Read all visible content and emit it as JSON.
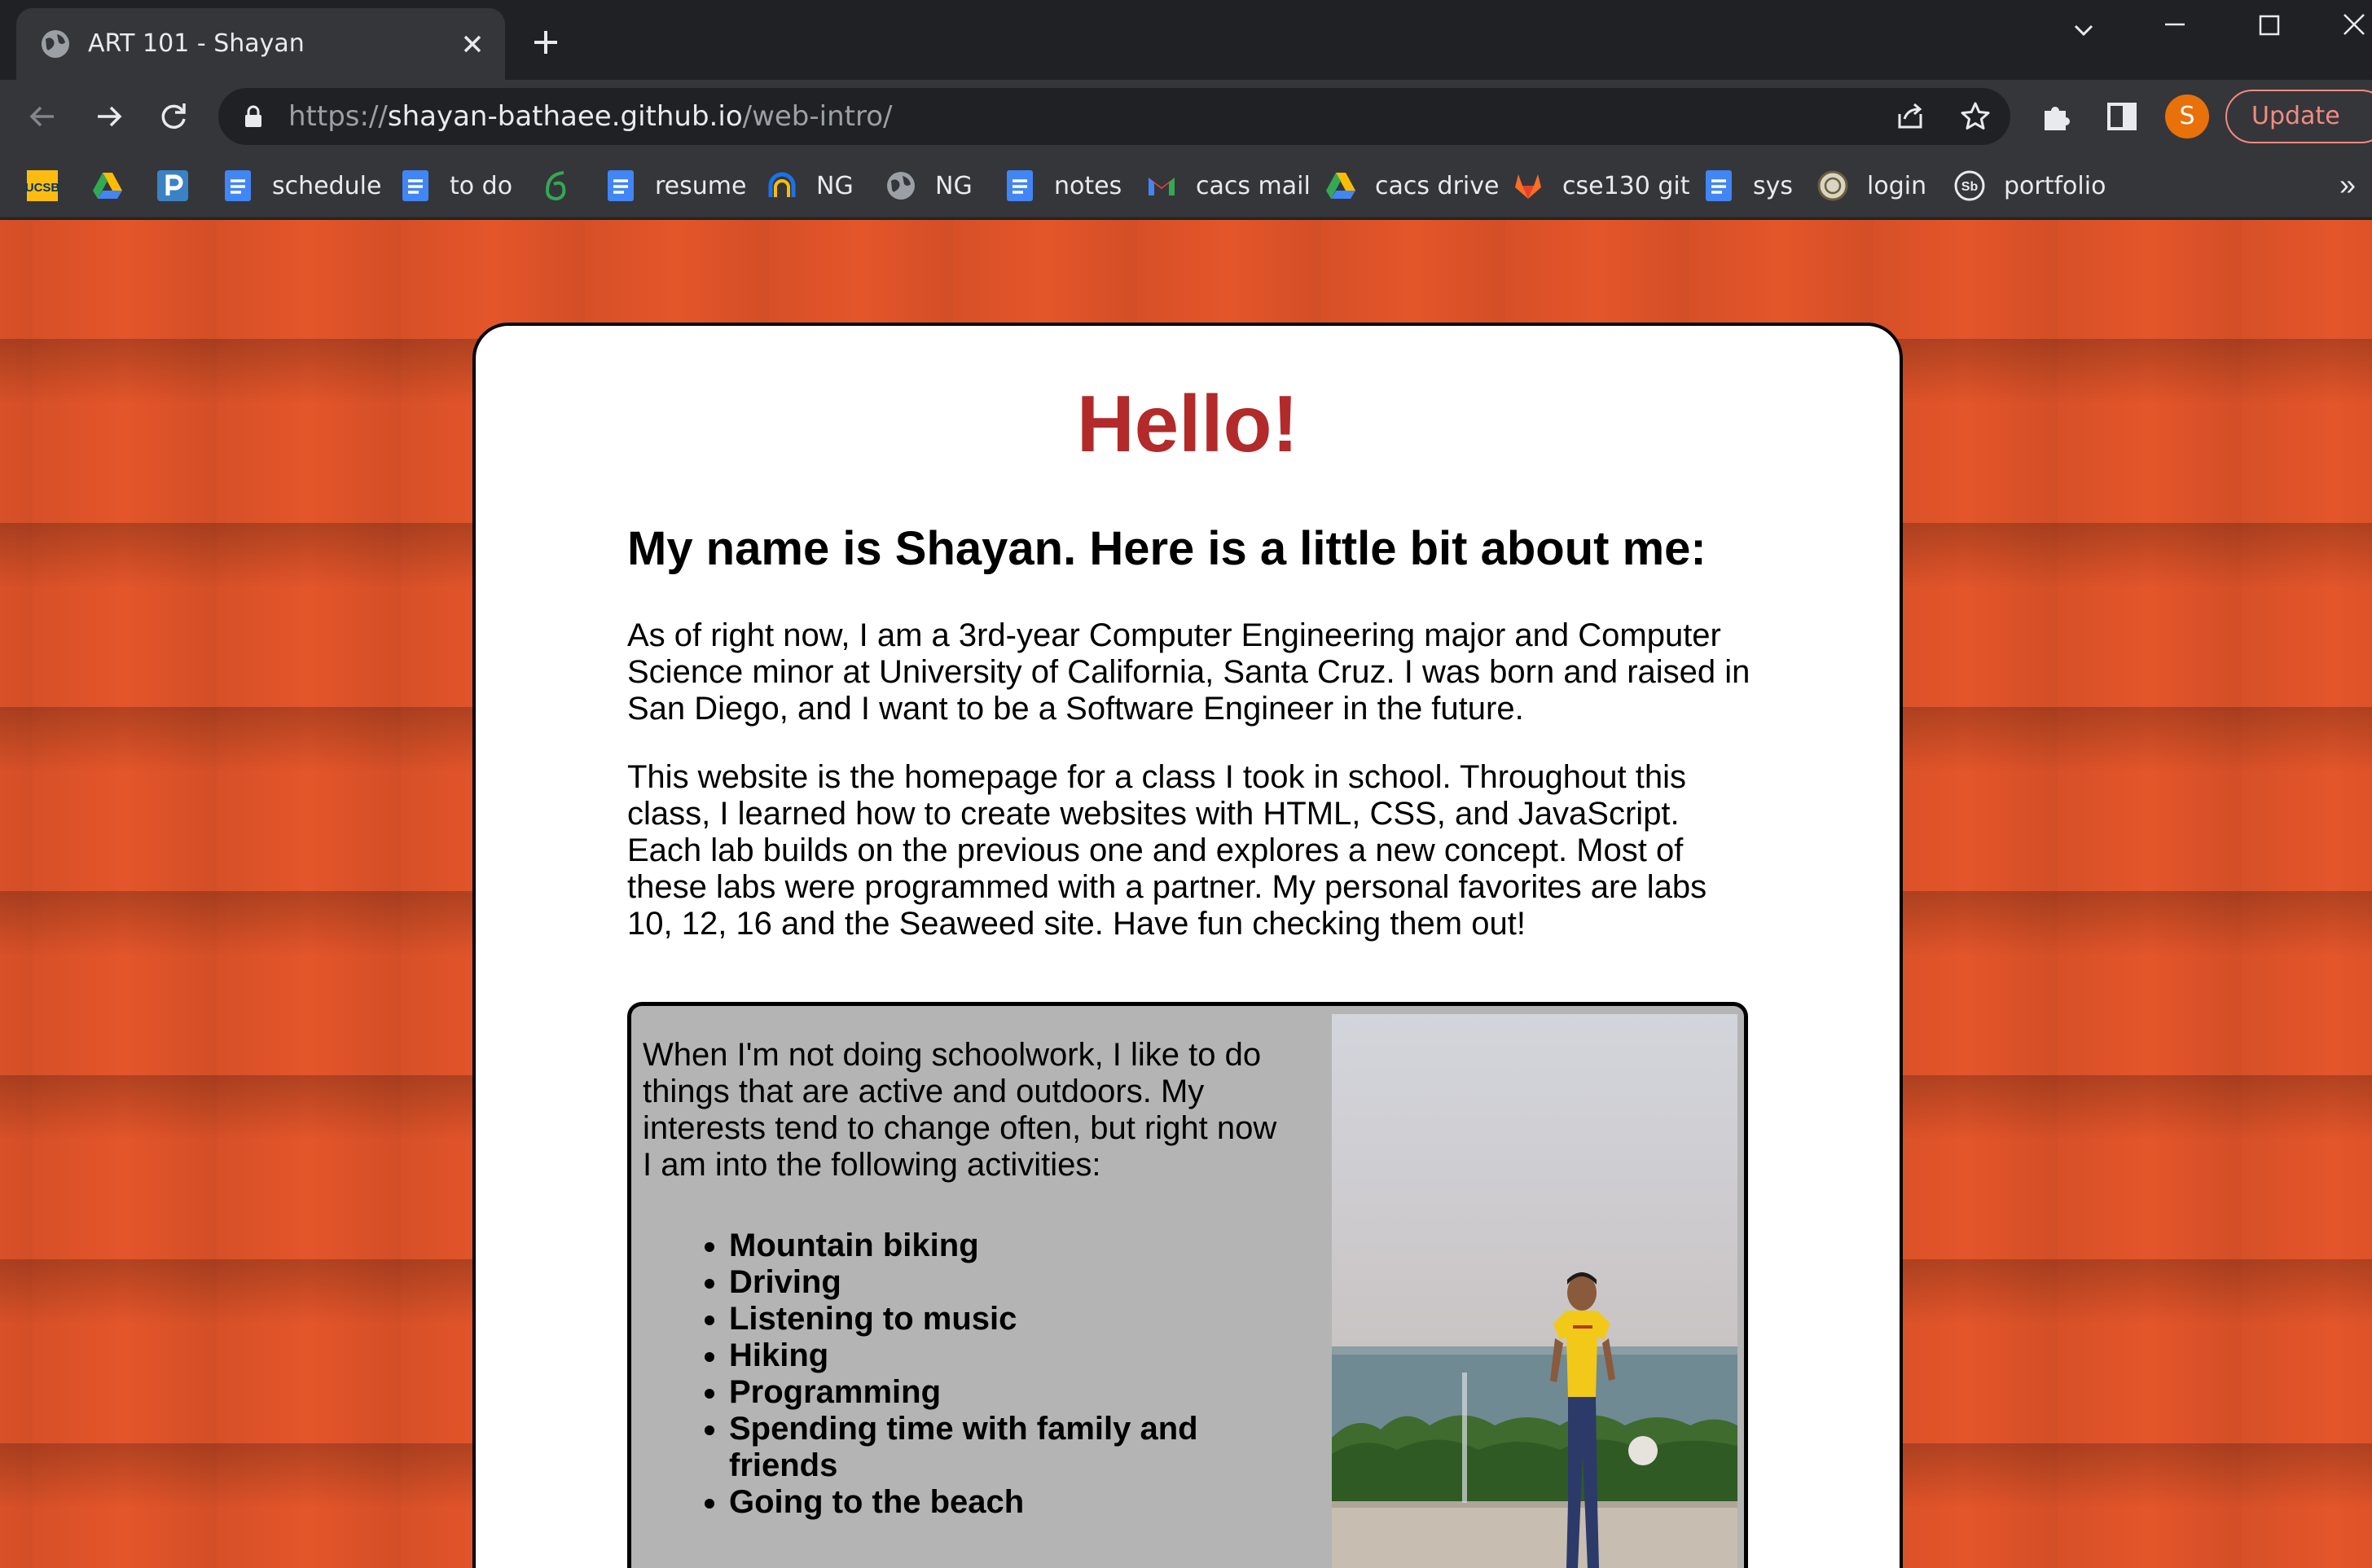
{
  "tab": {
    "title": "ART 101 - Shayan"
  },
  "address_bar": {
    "scheme": "https://",
    "host": "shayan-bathaee.github.io",
    "path": "/web-intro/"
  },
  "profile": {
    "initial": "S"
  },
  "update_button": {
    "label": "Update"
  },
  "bookmarks": [
    {
      "label": "",
      "icon": "ucsb-icon"
    },
    {
      "label": "",
      "icon": "google-drive-icon"
    },
    {
      "label": "",
      "icon": "p-icon"
    },
    {
      "label": "schedule",
      "icon": "docs-icon"
    },
    {
      "label": "to do",
      "icon": "docs-icon"
    },
    {
      "label": "",
      "icon": "leaf-icon"
    },
    {
      "label": "resume",
      "icon": "docs-icon"
    },
    {
      "label": "NG",
      "icon": "ng-icon"
    },
    {
      "label": "NG",
      "icon": "globe-icon"
    },
    {
      "label": "notes",
      "icon": "docs-icon"
    },
    {
      "label": "cacs mail",
      "icon": "gmail-icon"
    },
    {
      "label": "cacs drive",
      "icon": "google-drive-icon"
    },
    {
      "label": "cse130 git",
      "icon": "gitlab-icon"
    },
    {
      "label": "sys",
      "icon": "docs-icon"
    },
    {
      "label": "login",
      "icon": "seal-icon"
    },
    {
      "label": "portfolio",
      "icon": "sb-icon"
    }
  ],
  "page": {
    "heading": "Hello!",
    "intro": "My name is Shayan. Here is a little bit about me:",
    "paragraph1": "As of right now, I am a 3rd-year Computer Engineering major and Computer Science minor at University of California, Santa Cruz. I was born and raised in San Diego, and I want to be a Software Engineer in the future.",
    "paragraph2": "This website is the homepage for a class I took in school. Throughout this class, I learned how to create websites with HTML, CSS, and JavaScript. Each lab builds on the previous one and explores a new concept. Most of these labs were programmed with a partner. My personal favorites are labs 10, 12, 16 and the Seaweed site. Have fun checking them out!",
    "hobbies_intro": "When I'm not doing schoolwork, I like to do things that are active and outdoors. My interests tend to change often, but right now I am into the following activities:",
    "hobbies": [
      "Mountain biking",
      "Driving",
      "Listening to music",
      "Hiking",
      "Programming",
      "Spending time with family and friends",
      "Going to the beach"
    ]
  },
  "colors": {
    "background": "#e4552a",
    "heading": "#b22a2a",
    "hobby_box": "#b4b4b4",
    "chrome": "#35363a"
  }
}
